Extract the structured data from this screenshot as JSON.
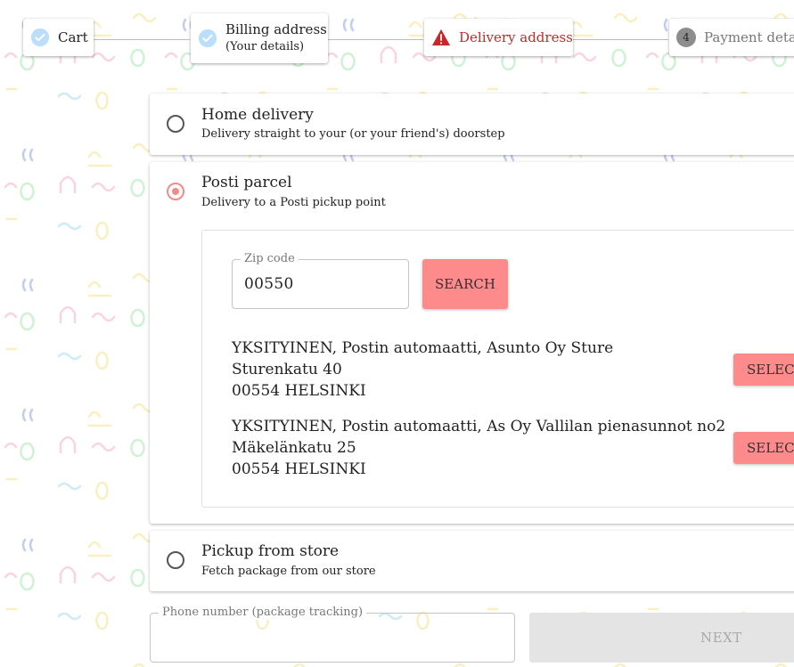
{
  "colors": {
    "accent": "#fd8b8b",
    "error": "#c62828",
    "done": "#bbdefb",
    "disabled": "#e4e4e4"
  },
  "stepper": {
    "steps": [
      {
        "label": "Cart",
        "icon": "check-circle-icon"
      },
      {
        "label": "Billing address",
        "sub": "(Your details)",
        "icon": "check-circle-icon"
      },
      {
        "label": "Delivery address",
        "icon": "warning-icon"
      },
      {
        "label": "Payment details",
        "number": "4"
      }
    ]
  },
  "delivery": {
    "options": [
      {
        "title": "Home delivery",
        "subtitle": "Delivery straight to your (or your friend's) doorstep",
        "selected": false
      },
      {
        "title": "Posti parcel",
        "subtitle": "Delivery to a Posti pickup point",
        "selected": true
      },
      {
        "title": "Pickup from store",
        "subtitle": "Fetch package from our store",
        "selected": false
      }
    ],
    "zip": {
      "label": "Zip code",
      "value": "00550"
    },
    "search_label": "SEARCH",
    "pickup_points": [
      {
        "name": "YKSITYINEN, Postin automaatti, Asunto Oy Sture",
        "street": "Sturenkatu 40",
        "city": "00554 HELSINKI",
        "button": "SELECT"
      },
      {
        "name": "YKSITYINEN, Postin automaatti, As Oy Vallilan pienasunnot no2",
        "street": "Mäkelänkatu 25",
        "city": "00554 HELSINKI",
        "button": "SELECT"
      }
    ]
  },
  "phone": {
    "label": "Phone number (package tracking)",
    "value": ""
  },
  "next_label": "NEXT"
}
